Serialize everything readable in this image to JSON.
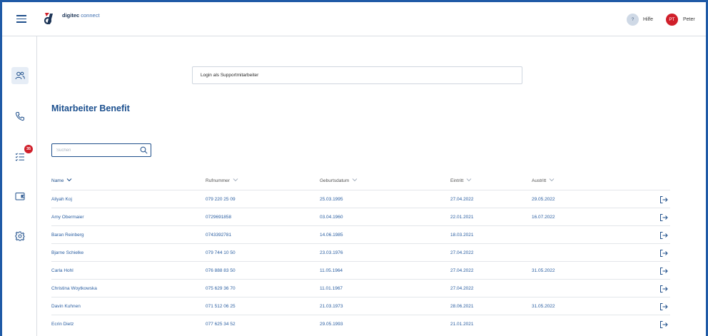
{
  "header": {
    "logo_brand": "digitec",
    "logo_product": "connect",
    "help_initial": "?",
    "help_label": "Hilfe",
    "user_initials": "PT",
    "user_name": "Peter"
  },
  "sidebar": {
    "items": [
      {
        "icon": "users-icon",
        "active": true
      },
      {
        "icon": "phone-icon",
        "active": false
      },
      {
        "icon": "task-list-icon",
        "active": false,
        "badge": "35"
      },
      {
        "icon": "wallet-icon",
        "active": false
      },
      {
        "icon": "gear-icon",
        "active": false
      }
    ]
  },
  "main": {
    "login_support_label": "Login als Supportmitarbeiter",
    "title": "Mitarbeiter Benefit",
    "search_placeholder": "Suchen",
    "columns": [
      "Name",
      "Rufnummer",
      "Geburtsdatum",
      "Eintritt",
      "Austritt"
    ],
    "sorted_column": "Name",
    "rows": [
      {
        "name": "Aliyah Koj",
        "phone": "079 220 25 09",
        "birth": "25.03.1995",
        "entry": "27.04.2022",
        "exit": "29.05.2022"
      },
      {
        "name": "Amy Obermaier",
        "phone": "0729691858",
        "birth": "03.04.1960",
        "entry": "22.01.2021",
        "exit": "16.07.2022"
      },
      {
        "name": "Baran Reinberg",
        "phone": "0743392781",
        "birth": "14.06.1985",
        "entry": "18.03.2021",
        "exit": ""
      },
      {
        "name": "Bjarne Schielke",
        "phone": "079 744 10 50",
        "birth": "23.03.1976",
        "entry": "27.04.2022",
        "exit": ""
      },
      {
        "name": "Carla Hohl",
        "phone": "076 888 83 50",
        "birth": "11.05.1964",
        "entry": "27.04.2022",
        "exit": "31.05.2022"
      },
      {
        "name": "Christina Woytkowska",
        "phone": "075 629 36 70",
        "birth": "11.01.1967",
        "entry": "27.04.2022",
        "exit": ""
      },
      {
        "name": "Davin Kuhnen",
        "phone": "071 512 06 25",
        "birth": "21.03.1973",
        "entry": "28.06.2021",
        "exit": "31.05.2022"
      },
      {
        "name": "Ecrin Dietz",
        "phone": "077 625 34 52",
        "birth": "29.05.1993",
        "entry": "21.01.2021",
        "exit": ""
      }
    ]
  },
  "colors": {
    "frame_blue": "#1f5aa6",
    "accent_blue": "#1f4f8b",
    "badge_red": "#d01f2a"
  }
}
